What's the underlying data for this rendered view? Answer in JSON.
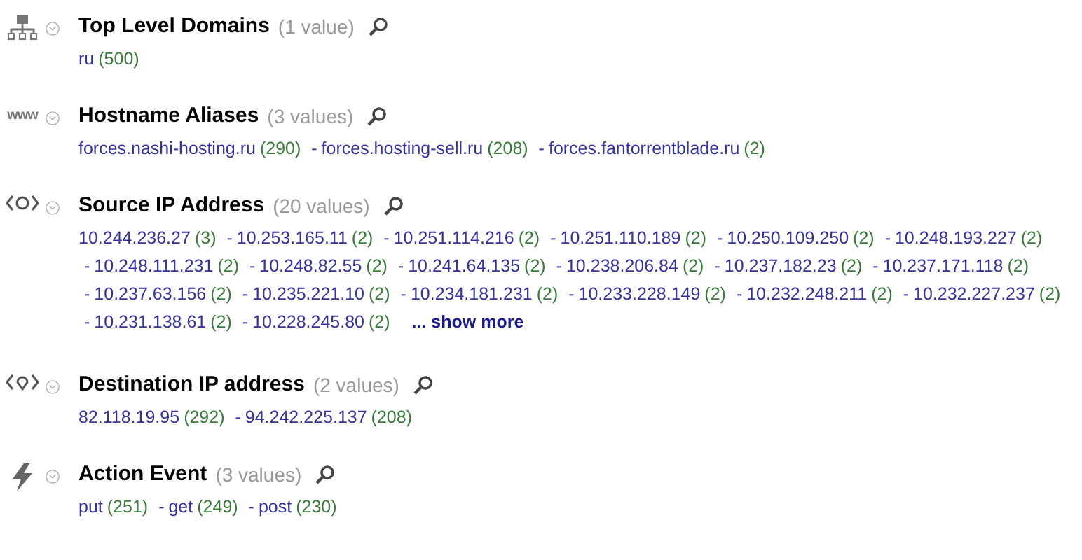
{
  "sections": [
    {
      "kind": "network",
      "title": "Top Level Domains",
      "count_label": "(1 value)",
      "values": [
        {
          "value": "ru",
          "count": "(500)"
        }
      ]
    },
    {
      "kind": "www",
      "icon_text": "www",
      "title": "Hostname Aliases",
      "count_label": "(3 values)",
      "values": [
        {
          "value": "forces.nashi-hosting.ru",
          "count": "(290)"
        },
        {
          "separator": "-",
          "value": "forces.hosting-sell.ru",
          "count": "(208)"
        },
        {
          "separator": "-",
          "value": "forces.fantorrentblade.ru",
          "count": "(2)"
        }
      ]
    },
    {
      "kind": "source-ip",
      "title": "Source IP Address",
      "count_label": "(20 values)",
      "values": [
        {
          "value": "10.244.236.27",
          "count": "(3)"
        },
        {
          "separator": "-",
          "value": "10.253.165.11",
          "count": "(2)"
        },
        {
          "separator": "-",
          "value": "10.251.114.216",
          "count": "(2)"
        },
        {
          "separator": "-",
          "value": "10.251.110.189",
          "count": "(2)"
        },
        {
          "separator": "-",
          "value": "10.250.109.250",
          "count": "(2)"
        },
        {
          "separator": "-",
          "value": "10.248.193.227",
          "count": "(2)"
        },
        {
          "separator": "-",
          "value": "10.248.111.231",
          "count": "(2)"
        },
        {
          "separator": "-",
          "value": "10.248.82.55",
          "count": "(2)"
        },
        {
          "separator": "-",
          "value": "10.241.64.135",
          "count": "(2)"
        },
        {
          "separator": "-",
          "value": "10.238.206.84",
          "count": "(2)"
        },
        {
          "separator": "-",
          "value": "10.237.182.23",
          "count": "(2)"
        },
        {
          "separator": "-",
          "value": "10.237.171.118",
          "count": "(2)"
        },
        {
          "separator": "-",
          "value": "10.237.63.156",
          "count": "(2)"
        },
        {
          "separator": "-",
          "value": "10.235.221.10",
          "count": "(2)"
        },
        {
          "separator": "-",
          "value": "10.234.181.231",
          "count": "(2)"
        },
        {
          "separator": "-",
          "value": "10.233.228.149",
          "count": "(2)"
        },
        {
          "separator": "-",
          "value": "10.232.248.211",
          "count": "(2)"
        },
        {
          "separator": "-",
          "value": "10.232.227.237",
          "count": "(2)"
        },
        {
          "separator": "-",
          "value": "10.231.138.61",
          "count": "(2)"
        },
        {
          "separator": "-",
          "value": "10.228.245.80",
          "count": "(2)"
        }
      ],
      "show_more": "... show more"
    },
    {
      "kind": "dest-ip",
      "title": "Destination IP address",
      "count_label": "(2 values)",
      "values": [
        {
          "value": "82.118.19.95",
          "count": "(292)"
        },
        {
          "separator": "-",
          "value": "94.242.225.137",
          "count": "(208)"
        }
      ]
    },
    {
      "kind": "lightning",
      "title": "Action Event",
      "count_label": "(3 values)",
      "values": [
        {
          "value": "put",
          "count": "(251)"
        },
        {
          "separator": "-",
          "value": "get",
          "count": "(249)"
        },
        {
          "separator": "-",
          "value": "post",
          "count": "(230)"
        }
      ]
    }
  ]
}
